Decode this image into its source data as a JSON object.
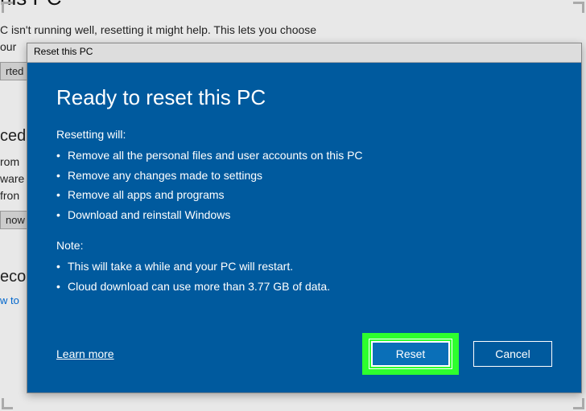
{
  "background": {
    "title_fragment": "his PC",
    "intro_line1": "C isn't running well, resetting it might help. This lets you choose",
    "intro_line2": "our",
    "btn_started": "rted",
    "section_advanced_fragment": "ced",
    "adv_line1": "rom",
    "adv_line2": "ware",
    "adv_line3": "fron",
    "btn_now": "now",
    "section_rec_fragment": "eco",
    "link_fragment": "w to"
  },
  "dialog": {
    "titlebar": "Reset this PC",
    "heading": "Ready to reset this PC",
    "resetting_label": "Resetting will:",
    "resetting_items": [
      "Remove all the personal files and user accounts on this PC",
      "Remove any changes made to settings",
      "Remove all apps and programs",
      "Download and reinstall Windows"
    ],
    "note_label": "Note:",
    "note_items": [
      "This will take a while and your PC will restart.",
      "Cloud download can use more than 3.77 GB of data."
    ],
    "learn_more": "Learn more",
    "reset_button": "Reset",
    "cancel_button": "Cancel"
  }
}
